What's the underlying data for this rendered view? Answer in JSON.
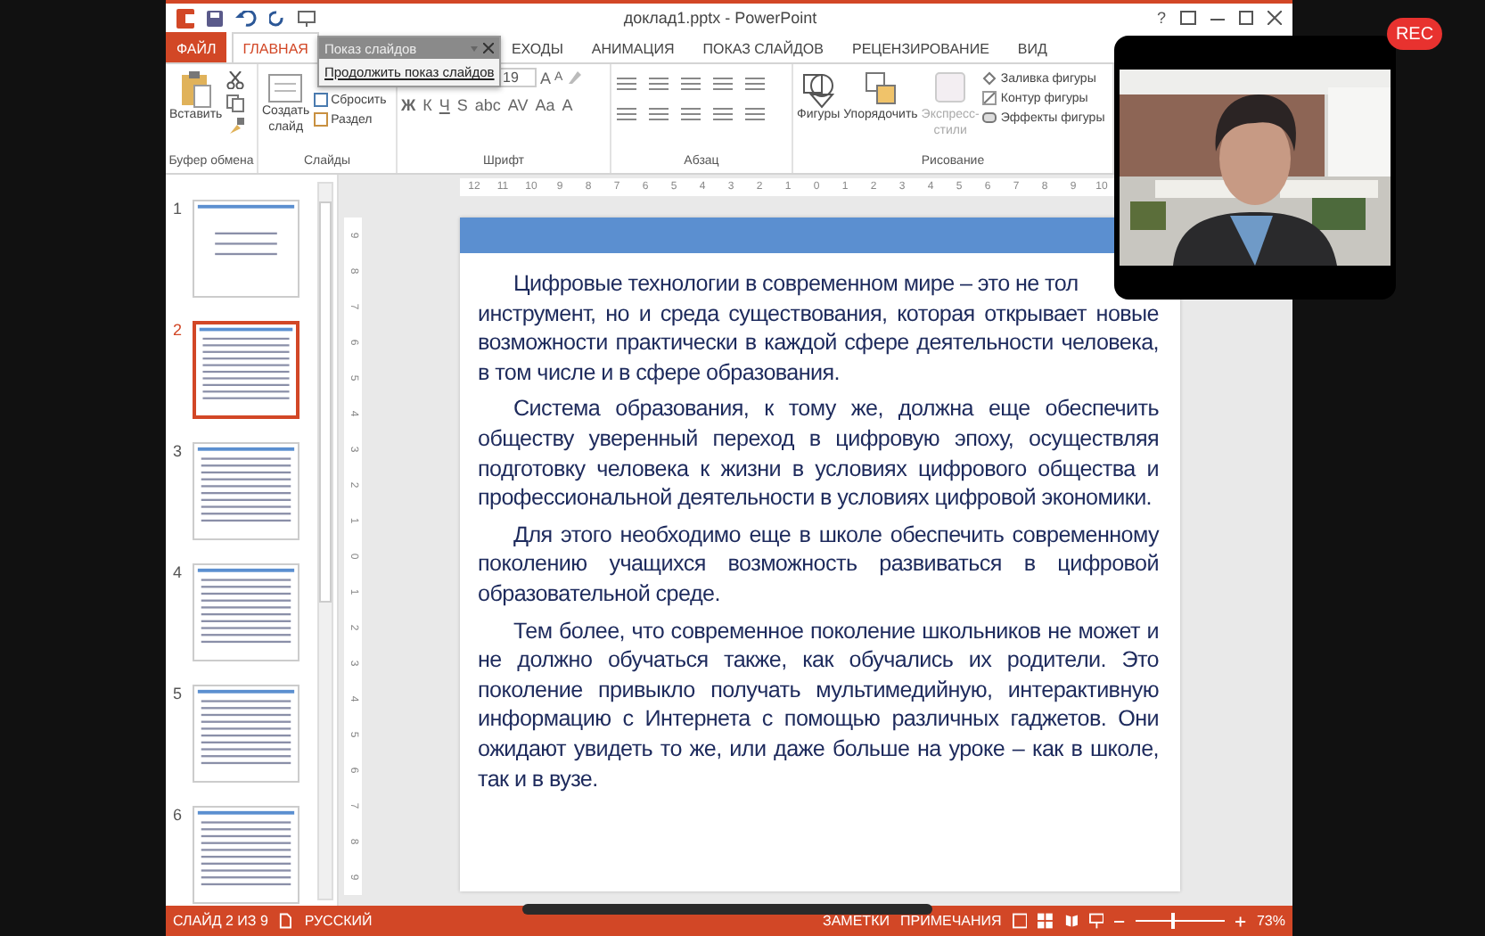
{
  "window": {
    "title": "доклад1.pptx - PowerPoint",
    "help": "?"
  },
  "tabs": [
    {
      "label": "ФАЙЛ",
      "kind": "file",
      "selected": false
    },
    {
      "label": "ГЛАВНАЯ",
      "kind": "tab",
      "selected": true
    },
    {
      "label": "ЕХОДЫ",
      "kind": "tab",
      "selected": false
    },
    {
      "label": "АНИМАЦИЯ",
      "kind": "tab",
      "selected": false
    },
    {
      "label": "ПОКАЗ СЛАЙДОВ",
      "kind": "tab",
      "selected": false
    },
    {
      "label": "РЕЦЕНЗИРОВАНИЕ",
      "kind": "tab",
      "selected": false
    },
    {
      "label": "ВИД",
      "kind": "tab",
      "selected": false
    }
  ],
  "popup": {
    "title": "Показ слайдов",
    "item": "Продолжить показ слайдов"
  },
  "ribbon": {
    "clipboard": {
      "label": "Буфер обмена",
      "paste": "Вставить"
    },
    "slides": {
      "label": "Слайды",
      "new_slide": [
        "Создать",
        "слайд"
      ],
      "reset": "Сбросить",
      "section": "Раздел"
    },
    "font": {
      "label": "Шрифт",
      "size": "19",
      "grow": "A",
      "shrink": "A",
      "styles": [
        "Ж",
        "К",
        "Ч",
        "S",
        "abc",
        "AV",
        "Aa"
      ],
      "font_color_button": "A"
    },
    "paragraph": {
      "label": "Абзац"
    },
    "drawing": {
      "label": "Рисование",
      "shapes": "Фигуры",
      "arrange": "Упорядочить",
      "quick_styles": {
        "lines": [
          "Экспресс-",
          "стили"
        ],
        "disabled": true
      },
      "fill": "Заливка фигуры",
      "outline": "Контур фигуры",
      "effects": "Эффекты фигуры"
    }
  },
  "thumbnails": [
    {
      "number": "1",
      "selected": false
    },
    {
      "number": "2",
      "selected": true
    },
    {
      "number": "3",
      "selected": false
    },
    {
      "number": "4",
      "selected": false
    },
    {
      "number": "5",
      "selected": false
    },
    {
      "number": "6",
      "selected": false
    }
  ],
  "top_ruler": [
    "12",
    "11",
    "10",
    "9",
    "8",
    "7",
    "6",
    "5",
    "4",
    "3",
    "2",
    "1",
    "0",
    "1",
    "2",
    "3",
    "4",
    "5",
    "6",
    "7",
    "8",
    "9",
    "10"
  ],
  "side_ruler": [
    "9",
    "8",
    "7",
    "6",
    "5",
    "4",
    "3",
    "2",
    "1",
    "0",
    "1",
    "2",
    "3",
    "4",
    "5",
    "6",
    "7",
    "8",
    "9"
  ],
  "slide": {
    "paragraphs": [
      {
        "lines": [
          "Цифровые технологии в современном мире – это не тол",
          "инструмент, но и среда существования, которая открывает новые",
          "возможности практически в каждой сфере деятельности человека,",
          "в том числе и в сфере образования."
        ]
      },
      {
        "lines": [
          "Система образования, к тому же, должна еще обеспечить",
          "обществу уверенный переход в цифровую эпоху, осуществляя",
          "подготовку человека к жизни в условиях цифрового общества и",
          "профессиональной деятельности в условиях цифровой экономики."
        ]
      },
      {
        "lines": [
          "Для этого необходимо еще в школе обеспечить современному",
          "поколению учащихся возможность развиваться в цифровой",
          "образовательной среде."
        ]
      },
      {
        "lines": [
          "Тем более, что современное поколение школьников не может и",
          "не должно обучаться также, как обучались их родители. Это",
          "поколение привыкло получать мультимедийную, интерактивную",
          "информацию с Интернета с помощью различных гаджетов. Они",
          "ожидают увидеть то же, или даже больше на уроке – как в школе,",
          "так и в вузе."
        ]
      }
    ]
  },
  "status_bar": {
    "slide": "СЛАЙД 2 ИЗ 9",
    "language": "РУССКИЙ",
    "notes": "ЗАМЕТКИ",
    "comments": "ПРИМЕЧАНИЯ",
    "zoom": "73%",
    "zoom_level": {
      "level": 0.4
    }
  },
  "recording": {
    "label": "REC"
  }
}
